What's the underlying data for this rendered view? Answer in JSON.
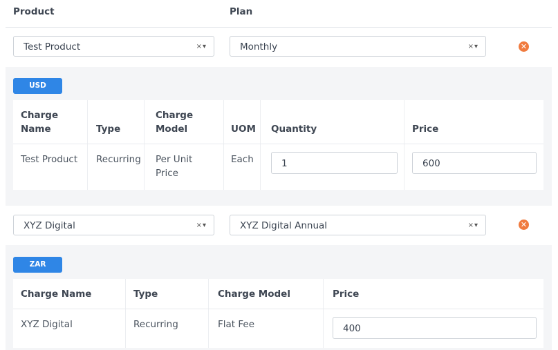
{
  "headers": {
    "product": "Product",
    "plan": "Plan"
  },
  "rows": [
    {
      "product": "Test Product",
      "plan": "Monthly",
      "select_controls": "×▾",
      "remove_icon": "✕",
      "currency": "USD",
      "columns": [
        "Charge Name",
        "Type",
        "Charge Model",
        "UOM",
        "Quantity",
        "Price"
      ],
      "charge": {
        "name": "Test Product",
        "type": "Recurring",
        "model": "Per Unit Price",
        "uom": "Each",
        "quantity": "1",
        "price": "600"
      }
    },
    {
      "product": "XYZ Digital",
      "plan": "XYZ Digital Annual",
      "select_controls": "×▾",
      "remove_icon": "✕",
      "currency": "ZAR",
      "columns": [
        "Charge Name",
        "Type",
        "Charge Model",
        "Price"
      ],
      "charge": {
        "name": "XYZ Digital",
        "type": "Recurring",
        "model": "Flat Fee",
        "price": "400"
      }
    }
  ],
  "colors": {
    "accent": "#2f86e6",
    "remove": "#f07b3f",
    "panel": "#f4f5f7"
  }
}
